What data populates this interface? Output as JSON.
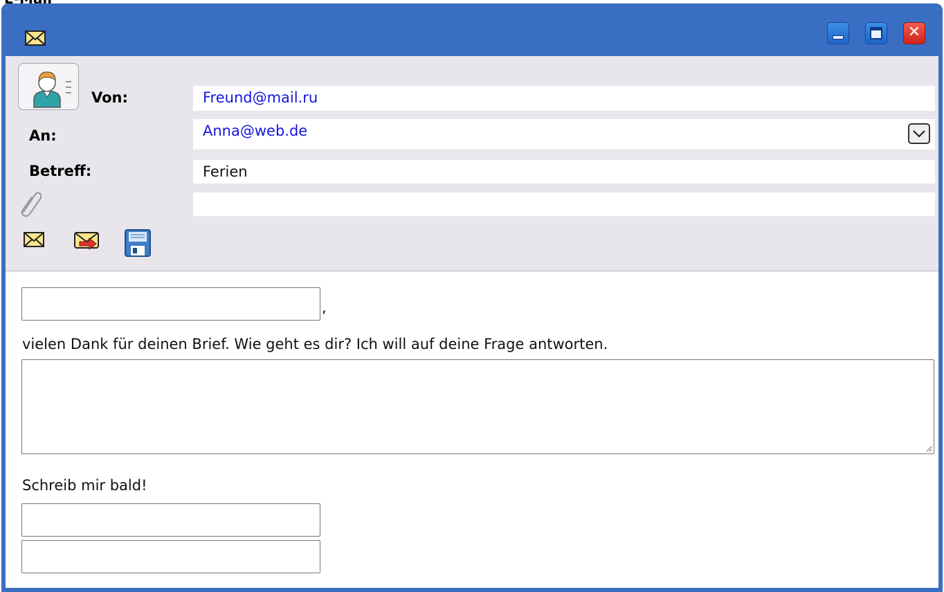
{
  "page": {
    "title": "E-Mail"
  },
  "window": {
    "controls": {
      "minimize_icon": "minimize-icon",
      "maximize_icon": "maximize-icon",
      "close_label": "✕"
    }
  },
  "header": {
    "from_label": "Von:",
    "from_value": "Freund@mail.ru",
    "to_label": "An:",
    "to_value": "Anna@web.de",
    "subject_label": "Betreff:",
    "subject_value": "Ferien",
    "attachment_value": ""
  },
  "toolbar": {
    "icons": [
      "mail-icon",
      "forward-mail-icon",
      "save-icon"
    ]
  },
  "body": {
    "greeting_input_value": "",
    "comma": ",",
    "intro_text": "vielen Dank für deinen Brief. Wie geht es dir? Ich will auf deine Frage antworten.",
    "answer_textarea_value": "",
    "closing_text": "Schreib mir bald!",
    "signature_line1_value": "",
    "signature_line2_value": ""
  },
  "colors": {
    "accent": "#3a6ec2",
    "header_bg": "#e9e6eb",
    "link": "#1515e0",
    "close": "#d9342b"
  }
}
